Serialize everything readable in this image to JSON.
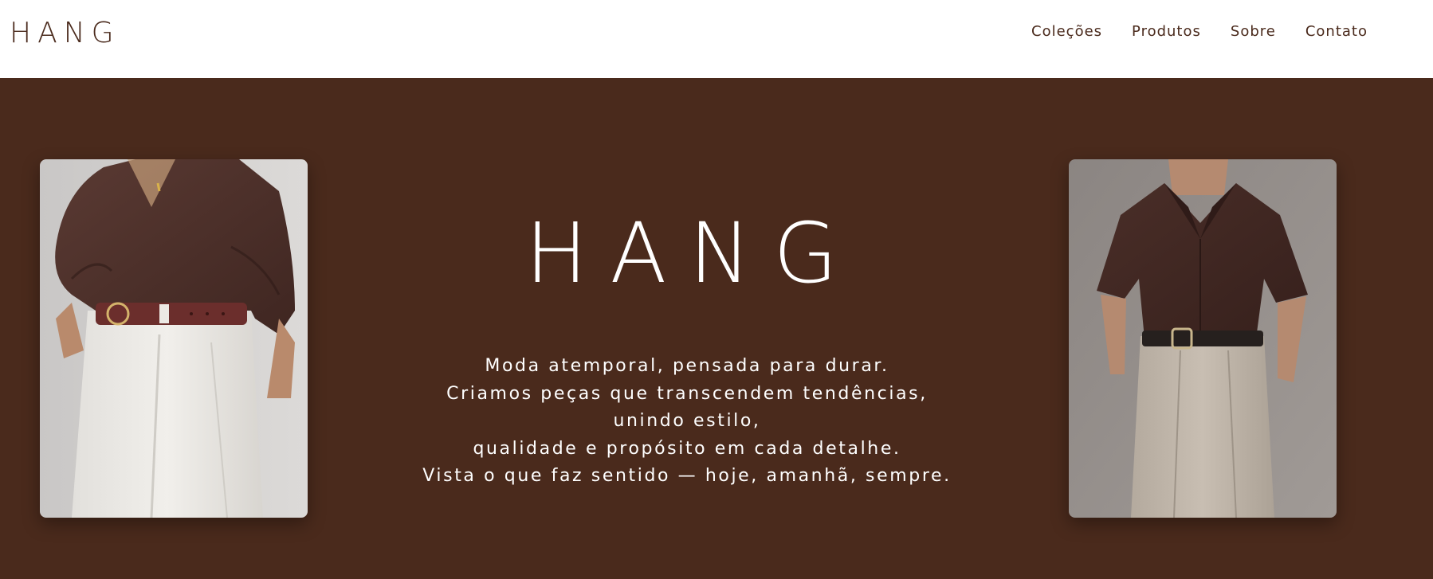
{
  "header": {
    "logo": "HANG",
    "nav": [
      {
        "label": "Coleções"
      },
      {
        "label": "Produtos"
      },
      {
        "label": "Sobre"
      },
      {
        "label": "Contato"
      }
    ]
  },
  "hero": {
    "title": "HANG",
    "lines": [
      "Moda atemporal, pensada para durar.",
      "Criamos peças que transcendem tendências,",
      "unindo estilo,",
      "qualidade e propósito em cada detalhe.",
      "Vista o que faz sentido — hoje, amanhã, sempre."
    ],
    "background_color": "#4a2a1c"
  },
  "images": {
    "left": "fashion photo: brown shirt, brown belt, white trousers",
    "right": "fashion photo: brown short-sleeve shirt, black belt, beige trousers"
  },
  "colors": {
    "brand_brown": "#4a2a1c",
    "header_bg": "#ffffff",
    "text_light": "#ffffff"
  }
}
